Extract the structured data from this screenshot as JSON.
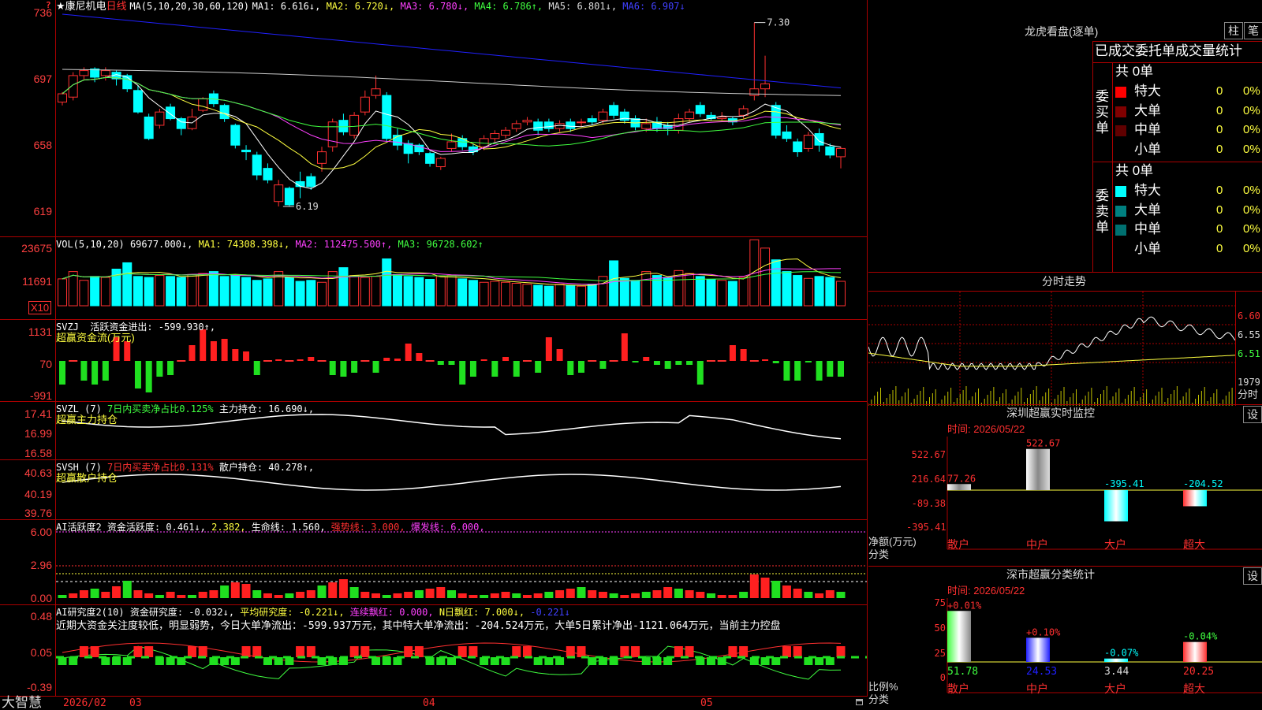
{
  "stock": {
    "star": "★",
    "name": "康尼机电",
    "period": "日线"
  },
  "corner_badge": "?",
  "legends": {
    "ma": {
      "label": "MA(5,10,20,30,60,120)",
      "items": [
        {
          "t": "MA1: 6.616↓,",
          "c": "#ffffff"
        },
        {
          "t": "MA2: 6.720↓,",
          "c": "#ffff40"
        },
        {
          "t": "MA3: 6.780↓,",
          "c": "#ff40ff"
        },
        {
          "t": "MA4: 6.786↑,",
          "c": "#40ff40"
        },
        {
          "t": "MA5: 6.801↓,",
          "c": "#dddddd"
        },
        {
          "t": "MA6: 6.907↓",
          "c": "#4040ff"
        }
      ]
    },
    "vol": {
      "label": "VOL(5,10,20)",
      "items": [
        {
          "t": "69677.000↓,",
          "c": "#ffffff"
        },
        {
          "t": "MA1: 74308.398↓,",
          "c": "#ffff40"
        },
        {
          "t": "MA2: 112475.500↑,",
          "c": "#ff40ff"
        },
        {
          "t": "MA3: 96728.602↑",
          "c": "#40ff40"
        }
      ]
    },
    "svzj": {
      "label": "SVZJ",
      "line1": "活跃资金进出: -599.930↑,",
      "line2": "超赢资金流(万元)"
    },
    "svzl": {
      "label": "SVZL (7)",
      "items": [
        {
          "t": "7日内买卖净占比0.125%",
          "c": "#40ff40"
        },
        {
          "t": "主力持仓: 16.690↓,",
          "c": "#ffffff"
        }
      ],
      "line2": "超赢主力持仓"
    },
    "svsh": {
      "label": "SVSH (7)",
      "items": [
        {
          "t": "7日内买卖净占比0.131%",
          "c": "#ff3030"
        },
        {
          "t": "散户持仓: 40.278↑,",
          "c": "#ffffff"
        }
      ],
      "line2": "超赢散户持仓"
    },
    "ai1": {
      "label": "AI活跃度2",
      "items": [
        {
          "t": "资金活跃度: 0.461↓,",
          "c": "#ffffff"
        },
        {
          "t": "2.382,",
          "c": "#ffff40"
        },
        {
          "t": "生命线: 1.560,",
          "c": "#ffffff"
        },
        {
          "t": "强势线: 3.000,",
          "c": "#ff3030"
        },
        {
          "t": "爆发线: 6.000,",
          "c": "#ff40ff"
        }
      ]
    },
    "ai2": {
      "label": "AI研究度2(10)",
      "items": [
        {
          "t": "资金研究度: -0.032↓,",
          "c": "#ffffff"
        },
        {
          "t": "平均研究度: -0.221↓,",
          "c": "#ffff40"
        },
        {
          "t": "连续飘红: 0.000,",
          "c": "#ff40ff"
        },
        {
          "t": "N日飘红: 7.000↓,",
          "c": "#ffff40"
        },
        {
          "t": "-0.221↓",
          "c": "#4040ff"
        }
      ],
      "comment": "近期大资金关注度较低，明显弱势，今日大单净流出：-599.937万元，其中特大单净流出：-204.524万元，大单5日累计净出-1121.064万元，当前主力控盘"
    }
  },
  "axes": {
    "price": [
      "736",
      "697",
      "658",
      "619"
    ],
    "vol": [
      "23675",
      "11691",
      "X10"
    ],
    "svzj": [
      "1131",
      "70",
      "-991"
    ],
    "svzl": [
      "17.41",
      "16.99",
      "16.58"
    ],
    "svsh": [
      "40.63",
      "40.19",
      "39.76"
    ],
    "ai1": [
      "6.00",
      "2.96",
      "0.00"
    ],
    "ai2": [
      "0.48",
      "0.05",
      "-0.39"
    ]
  },
  "annotations": {
    "high": "7.30",
    "low": "6.19"
  },
  "dates": [
    "2026/02",
    "03",
    "04",
    "05"
  ],
  "brand": "大智慧",
  "lhb": {
    "title": "龙虎看盘(逐单)",
    "btn_bar": "柱",
    "btn_pen": "笔",
    "tabs": [
      "已成交",
      "委托单",
      "成交量统计"
    ],
    "buy": {
      "side": "委买单",
      "total": "共 0单",
      "rows": [
        {
          "name": "特大",
          "v": "0",
          "p": "0%",
          "c": "#ff0000"
        },
        {
          "name": "大单",
          "v": "0",
          "p": "0%",
          "c": "#800000"
        },
        {
          "name": "中单",
          "v": "0",
          "p": "0%",
          "c": "#600000"
        },
        {
          "name": "小单",
          "v": "0",
          "p": "0%",
          "c": ""
        }
      ]
    },
    "sell": {
      "side": "委卖单",
      "total": "共 0单",
      "rows": [
        {
          "name": "特大",
          "v": "0",
          "p": "0%",
          "c": "#00ffff"
        },
        {
          "name": "大单",
          "v": "0",
          "p": "0%",
          "c": "#008080"
        },
        {
          "name": "中单",
          "v": "0",
          "p": "0%",
          "c": "#007070"
        },
        {
          "name": "小单",
          "v": "0",
          "p": "0%",
          "c": ""
        }
      ]
    }
  },
  "intraday": {
    "title": "分时走势",
    "prices": [
      "6.60",
      "6.55",
      "6.51"
    ],
    "vol": "1979",
    "vol_unit": "分时"
  },
  "sz_monitor": {
    "title": "深圳超赢实时监控",
    "btn": "设",
    "time": "时间: 2026/05/22",
    "ylabels": [
      "522.67",
      "216.64",
      "-89.38",
      "-395.41"
    ],
    "unit": "净额(万元)",
    "cat_label": "分类",
    "chart_data": {
      "type": "bar",
      "categories": [
        "散户",
        "中户",
        "大户",
        "超大"
      ],
      "values": [
        77.26,
        522.67,
        -395.41,
        -204.52
      ],
      "ylim": [
        -395.41,
        522.67
      ]
    }
  },
  "sz_class": {
    "title": "深市超赢分类统计",
    "btn": "设",
    "time": "时间: 2026/05/22",
    "ylabels": [
      "75",
      "50",
      "25",
      "0"
    ],
    "unit": "比例%",
    "cat_label": "分类",
    "chart_data": {
      "type": "bar",
      "categories": [
        "散户",
        "中户",
        "大户",
        "超大"
      ],
      "values": [
        51.78,
        24.53,
        3.44,
        20.25
      ],
      "changes": [
        "+0.01%",
        "+0.10%",
        "-0.07%",
        "-0.04%"
      ],
      "ylim": [
        0,
        75
      ]
    }
  }
}
